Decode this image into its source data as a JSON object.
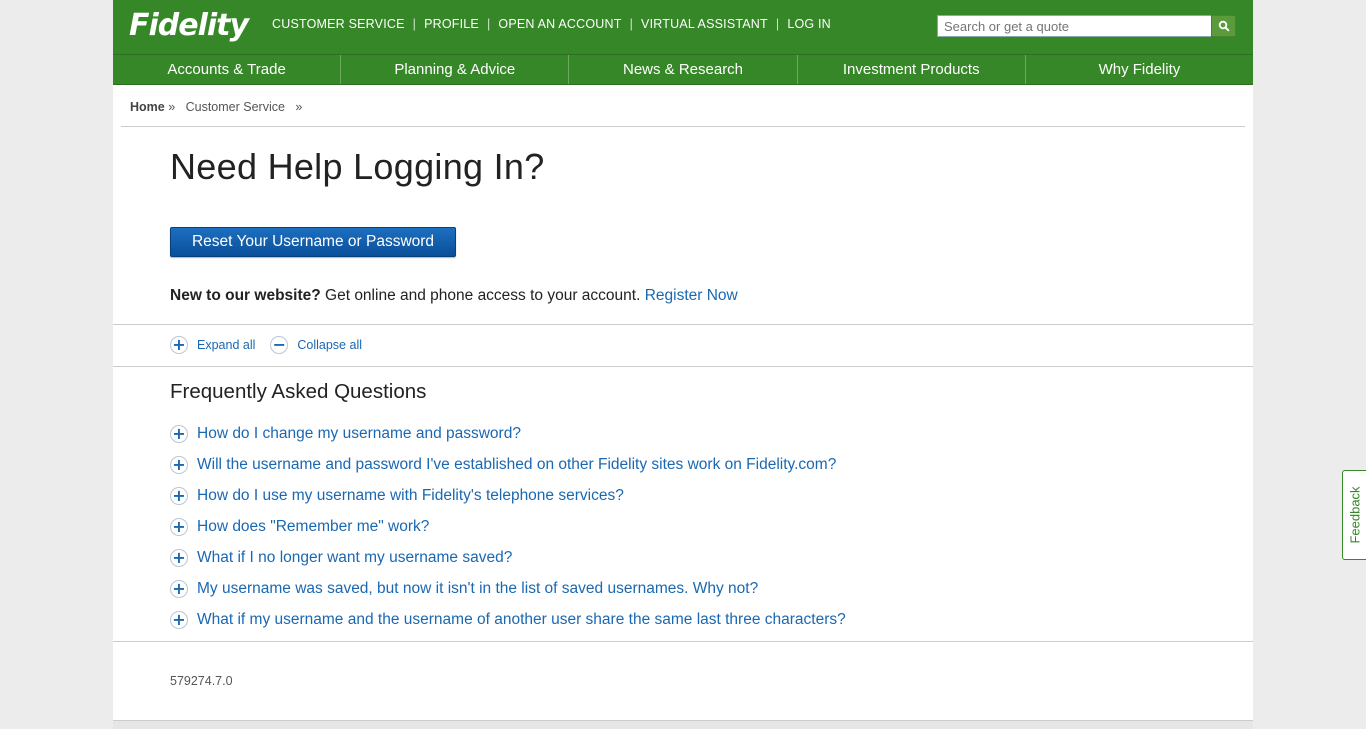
{
  "header": {
    "logo": "Fidelity",
    "utility_links": [
      "CUSTOMER SERVICE",
      "PROFILE",
      "OPEN AN ACCOUNT",
      "VIRTUAL ASSISTANT",
      "LOG IN"
    ],
    "search_placeholder": "Search or get a quote",
    "nav": [
      "Accounts & Trade",
      "Planning & Advice",
      "News & Research",
      "Investment Products",
      "Why Fidelity"
    ]
  },
  "breadcrumb": {
    "home": "Home",
    "sep1": "»",
    "current": "Customer Service",
    "sep2": "»"
  },
  "main": {
    "title": "Need Help Logging In?",
    "reset_button": "Reset Your Username or Password",
    "new_bold": "New to our website?",
    "new_text": " Get online and phone access to your account. ",
    "register_link": "Register Now",
    "expand_all": "Expand all",
    "collapse_all": "Collapse all",
    "faq_heading": "Frequently Asked Questions",
    "faqs": [
      "How do I change my username and password?",
      "Will the username and password I've established on other Fidelity sites work on Fidelity.com?",
      "How do I use my username with Fidelity's telephone services?",
      "How does \"Remember me\" work?",
      "What if I no longer want my username saved?",
      "My username was saved, but now it isn't in the list of saved usernames. Why not?",
      "What if my username and the username of another user share the same last three characters?"
    ],
    "version": "579274.7.0"
  },
  "feedback_tab": "Feedback",
  "colors": {
    "brand_green": "#368727",
    "link_blue": "#1a68b2",
    "button_blue": "#0a4f9a"
  }
}
